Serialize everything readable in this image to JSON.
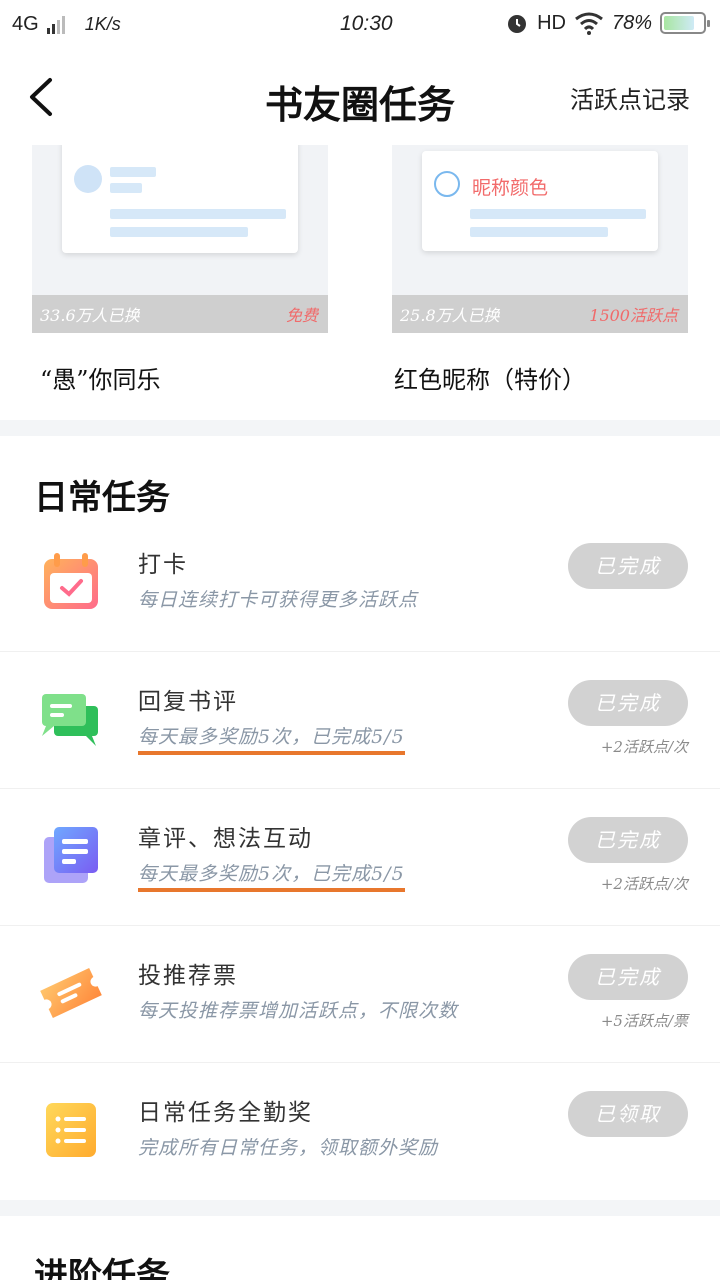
{
  "status_bar": {
    "network": "4G",
    "speed": "1K/s",
    "time": "10:30",
    "hd": "HD",
    "battery": "78%",
    "battery_level": 0.78
  },
  "header": {
    "title": "书友圈任务",
    "record_link": "活跃点记录"
  },
  "cards": [
    {
      "count": "33.6万人已换",
      "price": "免费",
      "name": "“愚”你同乐"
    },
    {
      "count": "25.8万人已换",
      "price": "1500活跃点",
      "name": "红色昵称（特价）",
      "preview_label": "昵称颜色"
    }
  ],
  "daily": {
    "title": "日常任务",
    "tasks": [
      {
        "title": "打卡",
        "desc": "每日连续打卡可获得更多活跃点",
        "button": "已完成",
        "reward": ""
      },
      {
        "title": "回复书评",
        "desc": "每天最多奖励5次，已完成5/5",
        "button": "已完成",
        "reward": "+2活跃点/次"
      },
      {
        "title": "章评、想法互动",
        "desc": "每天最多奖励5次，已完成5/5",
        "button": "已完成",
        "reward": "+2活跃点/次"
      },
      {
        "title": "投推荐票",
        "desc": "每天投推荐票增加活跃点，不限次数",
        "button": "已完成",
        "reward": "+5活跃点/票"
      },
      {
        "title": "日常任务全勤奖",
        "desc": "完成所有日常任务，领取额外奖励",
        "button": "已领取",
        "reward": ""
      }
    ]
  },
  "advanced": {
    "title": "进阶任务"
  },
  "colors": {
    "button_disabled": "#d2d2d2",
    "price_red": "#f06a6a",
    "underline_orange": "#e8772d",
    "desc_gray": "#8a97a6"
  }
}
